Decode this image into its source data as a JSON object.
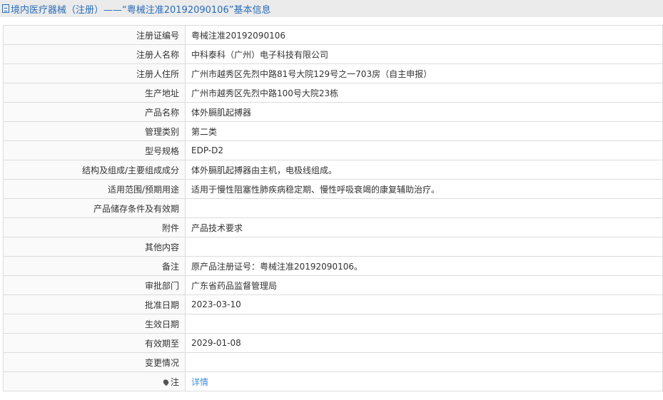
{
  "header": {
    "title": "境内医疗器械（注册）——“粤械注准20192090106”基本信息"
  },
  "rows": [
    {
      "label": "注册证编号",
      "value": "粤械注准20192090106"
    },
    {
      "label": "注册人名称",
      "value": "中科泰科（广州）电子科技有限公司"
    },
    {
      "label": "注册人住所",
      "value": "广州市越秀区先烈中路81号大院129号之一703房（自主申报）"
    },
    {
      "label": "生产地址",
      "value": "广州市越秀区先烈中路100号大院23栋"
    },
    {
      "label": "产品名称",
      "value": "体外膈肌起搏器"
    },
    {
      "label": "管理类别",
      "value": "第二类"
    },
    {
      "label": "型号规格",
      "value": "EDP-D2"
    },
    {
      "label": "结构及组成/主要组成成分",
      "value": "体外膈肌起搏器由主机，电极线组成。"
    },
    {
      "label": "适用范围/预期用途",
      "value": "适用于慢性阻塞性肺疾病稳定期、慢性呼吸衰竭的康复辅助治疗。"
    },
    {
      "label": "产品储存条件及有效期",
      "value": ""
    },
    {
      "label": "附件",
      "value": "产品技术要求"
    },
    {
      "label": "其他内容",
      "value": ""
    },
    {
      "label": "备注",
      "value": "原产品注册证号：粤械注准20192090106。"
    },
    {
      "label": "审批部门",
      "value": "广东省药品监督管理局"
    },
    {
      "label": "批准日期",
      "value": "2023-03-10"
    },
    {
      "label": "生效日期",
      "value": ""
    },
    {
      "label": "有效期至",
      "value": "2029-01-08"
    },
    {
      "label": "变更情况",
      "value": ""
    }
  ],
  "note": {
    "label": "注",
    "link": "详情"
  }
}
